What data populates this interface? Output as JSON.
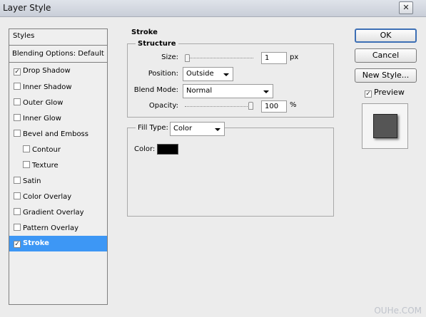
{
  "window": {
    "title": "Layer Style",
    "close_glyph": "✕"
  },
  "styles_panel": {
    "header": "Styles",
    "blending_options": "Blending Options: Default",
    "items": [
      {
        "label": "Drop Shadow",
        "checked": true,
        "selected": false,
        "indent": false
      },
      {
        "label": "Inner Shadow",
        "checked": false,
        "selected": false,
        "indent": false
      },
      {
        "label": "Outer Glow",
        "checked": false,
        "selected": false,
        "indent": false
      },
      {
        "label": "Inner Glow",
        "checked": false,
        "selected": false,
        "indent": false
      },
      {
        "label": "Bevel and Emboss",
        "checked": false,
        "selected": false,
        "indent": false
      },
      {
        "label": "Contour",
        "checked": false,
        "selected": false,
        "indent": true
      },
      {
        "label": "Texture",
        "checked": false,
        "selected": false,
        "indent": true
      },
      {
        "label": "Satin",
        "checked": false,
        "selected": false,
        "indent": false
      },
      {
        "label": "Color Overlay",
        "checked": false,
        "selected": false,
        "indent": false
      },
      {
        "label": "Gradient Overlay",
        "checked": false,
        "selected": false,
        "indent": false
      },
      {
        "label": "Pattern Overlay",
        "checked": false,
        "selected": false,
        "indent": false
      },
      {
        "label": "Stroke",
        "checked": true,
        "selected": true,
        "indent": false
      }
    ]
  },
  "stroke": {
    "heading": "Stroke",
    "structure": {
      "heading": "Structure",
      "size_label": "Size:",
      "size_value": "1",
      "size_unit": "px",
      "size_slider_fraction": 0.0,
      "position_label": "Position:",
      "position_value": "Outside",
      "blend_mode_label": "Blend Mode:",
      "blend_mode_value": "Normal",
      "opacity_label": "Opacity:",
      "opacity_value": "100",
      "opacity_unit": "%",
      "opacity_slider_fraction": 1.0
    },
    "fill": {
      "fill_type_label": "Fill Type:",
      "fill_type_value": "Color",
      "color_label": "Color:",
      "color_hex": "#000000"
    }
  },
  "buttons": {
    "ok": "OK",
    "cancel": "Cancel",
    "new_style": "New Style..."
  },
  "preview": {
    "label": "Preview",
    "checked": true,
    "swatch_color": "#555555"
  },
  "watermark": "OUHe.COM",
  "colors": {
    "selection": "#3d97f5",
    "dialog_bg": "#ececec"
  }
}
